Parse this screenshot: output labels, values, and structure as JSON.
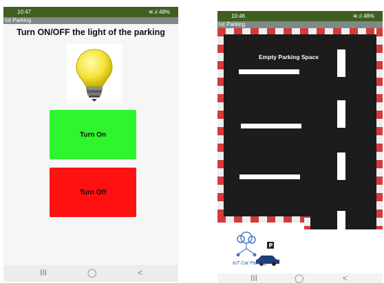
{
  "left_screen": {
    "status": {
      "time": "10:47",
      "indicators": "≋.ıl 48%"
    },
    "app_title": "Iot Parking",
    "heading": "Turn ON/OFF the light of the parking",
    "icons": {
      "bulb": "light-bulb-icon"
    },
    "buttons": {
      "on": {
        "label": "Turn On",
        "color": "#2ef52e"
      },
      "off": {
        "label": "Turn Off",
        "color": "#ff1111"
      }
    },
    "nav": {
      "recents": "III",
      "home": "◯",
      "back": "<"
    }
  },
  "right_screen": {
    "status": {
      "time": "10:46",
      "indicators": "≋.ıl 48%"
    },
    "app_title": "Iot Parking",
    "map_label": "Empty Parking Space",
    "logo": {
      "text": "IoT Car Parking",
      "icon": "iot-car-parking-logo"
    },
    "nav": {
      "recents": "III",
      "home": "◯",
      "back": "<"
    }
  },
  "colors": {
    "status_bar": "#3f5e20",
    "title_bar": "#7f8a86",
    "asphalt": "#1c1c1c",
    "curb_red": "#d43a3a",
    "curb_white": "#eeeeee"
  }
}
